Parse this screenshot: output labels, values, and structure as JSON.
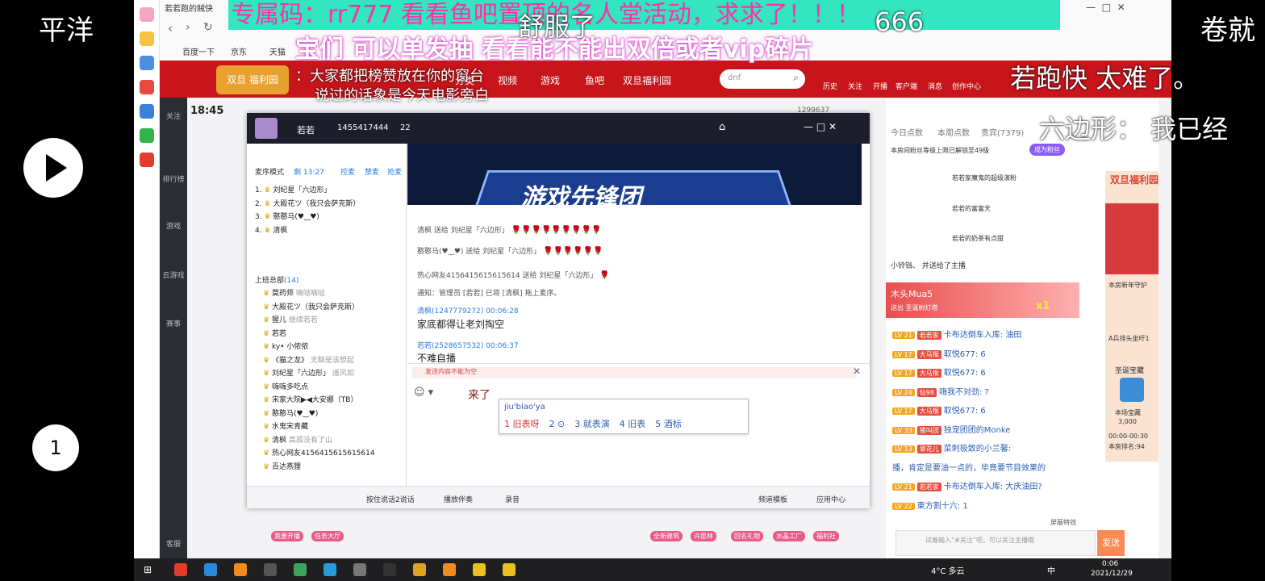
{
  "overlay": {
    "pinned_line1": "专属码：rr777 看看鱼吧置顶的名人堂活动，求求了！！！",
    "pinned_line2": "宝们 可以单发抽 看看能不能出双倍或者vip碎片",
    "danmu": [
      "舒服了",
      "666",
      "若跑快  太难了。",
      "六边形：  我已经",
      "平洋",
      "卷就",
      "：大家都把榜赞放在你的窗台",
      "说过的话象是今天电影旁白"
    ],
    "play_count": "1"
  },
  "browser": {
    "tab_title": "若若跑的贼快",
    "bookmarks": [
      "百度一下",
      "京东",
      "天猫"
    ]
  },
  "site_nav": {
    "logo_text": "双旦 福利园",
    "items": [
      "分类",
      "视频",
      "游戏",
      "鱼吧",
      "双旦福利园"
    ],
    "search_placeholder": "dnf",
    "icons": [
      "历史",
      "关注",
      "开播",
      "客户端",
      "消息",
      "创作中心"
    ],
    "time": "18:45",
    "room_hot": "1299637"
  },
  "left_sidebar": [
    "关注",
    "排行榜",
    "游戏",
    "云游戏",
    "赛事",
    "客服"
  ],
  "app": {
    "owner": "若若",
    "room_id": "1455417444",
    "online": "22",
    "queue_mode": "麦序模式",
    "queue_time": "剩 13:27",
    "queue_actions": [
      "控麦",
      "禁麦",
      "抢麦"
    ],
    "queue": [
      {
        "no": "1.",
        "name": "刘纪星「六边形」"
      },
      {
        "no": "2.",
        "name": "大殿花ツ（我只会萨克斯）"
      },
      {
        "no": "3.",
        "name": "憨憨马(♥‿♥)"
      },
      {
        "no": "4.",
        "name": "清枫"
      }
    ],
    "group_title": "上班总部",
    "group_count": "(14)",
    "members": [
      {
        "name": "莫药师",
        "note": "嘀哒嘀哒"
      },
      {
        "name": "大殿花ツ（我只会萨克斯）",
        "note": ""
      },
      {
        "name": "猩儿",
        "note": "继续若若"
      },
      {
        "name": "若若",
        "note": ""
      },
      {
        "name": "ky• 小侬侬",
        "note": ""
      },
      {
        "name": "《猫之龙》",
        "note": "无聊是该想起"
      },
      {
        "name": "刘纪星「六边形」",
        "note": "遥风如"
      },
      {
        "name": "嗨嗨多吃点",
        "note": ""
      },
      {
        "name": "宋家大院▶◀大安娜（TB）",
        "note": ""
      },
      {
        "name": "憨憨马(♥‿♥)",
        "note": ""
      },
      {
        "name": "水鬼宋青藏",
        "note": ""
      },
      {
        "name": "清枫",
        "note": "高孤没有了山"
      },
      {
        "name": "热心网友4156415615615614",
        "note": ""
      },
      {
        "name": "百达燕狸",
        "note": ""
      }
    ],
    "banner_text": "游戏先锋团",
    "chat": [
      "清枫 送给 刘纪星「六边形」",
      "憨憨马(♥‿♥) 送给 刘纪星「六边形」",
      "热心网友4156415615615614 送给 刘纪星「六边形」",
      "通知：管理员 [若若] 已将 [清枫] 拖上麦序。",
      "清枫(1247779272)  00:06:28",
      "家底都得让老刘掏空",
      "若若(2528657532)  00:06:37",
      "不难自播"
    ],
    "input_placeholder": "发送内容不能为空",
    "input_text": "来了",
    "ime_pinyin": "jiu'biao'ya",
    "ime_candidates": [
      "1 旧表呀",
      "2 ⊙",
      "3 就表演",
      "4 旧表",
      "5 酒标"
    ],
    "bottom": [
      "按住说话2说话",
      "播放伴奏",
      "录音",
      "频道模板",
      "应用中心"
    ]
  },
  "right_panel": {
    "top_tabs": [
      "今日点数",
      "本周点数",
      "贵宾(7379)"
    ],
    "guard_note": "本房间粉丝等级上限已解锁至49级",
    "become_fan": "成为粉丝",
    "ranks": [
      "若若家魔鬼的超级演粉",
      "若若的富富天",
      "若若的奶茶有点甜"
    ],
    "system": "小铃铛、  并送给了主播",
    "gift_user": "木头Mua5",
    "gift_text": "送出  圣诞树灯塔",
    "gift_mult": "x1",
    "comments": [
      {
        "lv": "LV 21",
        "tag": "若若家",
        "text": "卡布达倒车入库:  油田"
      },
      {
        "lv": "LV 17",
        "tag": "大马猴",
        "text": "取悦677:  6"
      },
      {
        "lv": "LV 17",
        "tag": "大马猴",
        "text": "取悦677:  6"
      },
      {
        "lv": "LV 24",
        "tag": "仙98",
        "text": "嗨我不对劲:  ?"
      },
      {
        "lv": "LV 17",
        "tag": "大马猴",
        "text": "取悦677:  6"
      },
      {
        "lv": "LV 33",
        "tag": "猪叫团",
        "text": "独宠团团的Monke"
      },
      {
        "lv": "LV 13",
        "tag": "翠花儿",
        "text": "菜刺极致的小兰馨:"
      },
      {
        "lv": "",
        "tag": "",
        "text": "播，肯定是要油一点的，毕竟要节目效果的"
      },
      {
        "lv": "LV 21",
        "tag": "若若家",
        "text": "卡布达倒车入库:  大庆油田?"
      },
      {
        "lv": "LV 22",
        "tag": "",
        "text": "東方割十六:  1"
      }
    ],
    "input_placeholder": "试着输入“#关注”吧，可以关注主播哦",
    "send": "发送",
    "shield": "屏蔽特效",
    "promo": {
      "title": "双旦福利园",
      "rank": "本房新年守护",
      "rank2": "A兵排头坐吁1",
      "box": "圣诞宝藏",
      "box_label": "本场宝藏",
      "box_val": "3,000",
      "time": "00:00-00:30",
      "place": "本房排名:94"
    }
  },
  "bottom_bar": [
    "我要开播",
    "任务大厅",
    "全新建筑",
    "许愿林",
    "回名礼物",
    "水晶工厂",
    "福利社"
  ],
  "taskbar": {
    "weather": "4°C 多云",
    "time": "0:06",
    "date": "2021/12/29",
    "lang": "中"
  }
}
